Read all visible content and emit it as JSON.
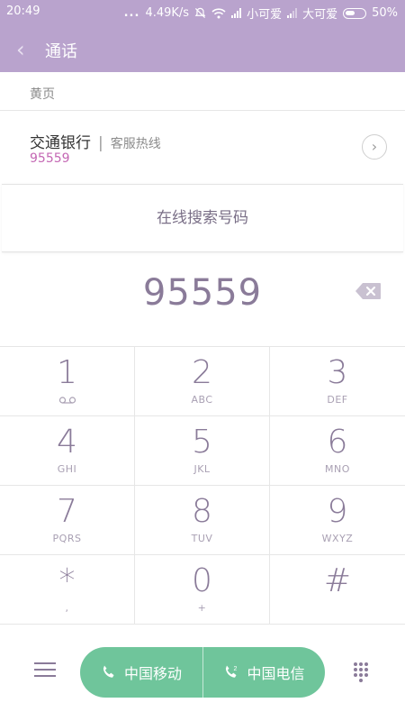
{
  "status_bar": {
    "time": "20:49",
    "dots": "...",
    "net_speed": "4.49K/s",
    "carrier1": "小可爱",
    "carrier2": "大可爱",
    "battery": "50%"
  },
  "header": {
    "title": "通话"
  },
  "yellow_pages": {
    "section_label": "黄页",
    "result": {
      "name": "交通银行",
      "separator": "|",
      "tag": "客服热线",
      "number": "95559"
    }
  },
  "search_online": "在线搜索号码",
  "input_number": "95559",
  "keypad": [
    {
      "digit": "1",
      "letters": ""
    },
    {
      "digit": "2",
      "letters": "ABC"
    },
    {
      "digit": "3",
      "letters": "DEF"
    },
    {
      "digit": "4",
      "letters": "GHI"
    },
    {
      "digit": "5",
      "letters": "JKL"
    },
    {
      "digit": "6",
      "letters": "MNO"
    },
    {
      "digit": "7",
      "letters": "PQRS"
    },
    {
      "digit": "8",
      "letters": "TUV"
    },
    {
      "digit": "9",
      "letters": "WXYZ"
    },
    {
      "digit": "*",
      "letters": ","
    },
    {
      "digit": "0",
      "letters": "+"
    },
    {
      "digit": "#",
      "letters": ""
    }
  ],
  "call_buttons": {
    "sim1": "中国移动",
    "sim2": "中国电信"
  },
  "colors": {
    "header": "#b9a3cd",
    "accent": "#8a7b99",
    "call": "#6fc59b",
    "number_highlight": "#c468b4"
  }
}
